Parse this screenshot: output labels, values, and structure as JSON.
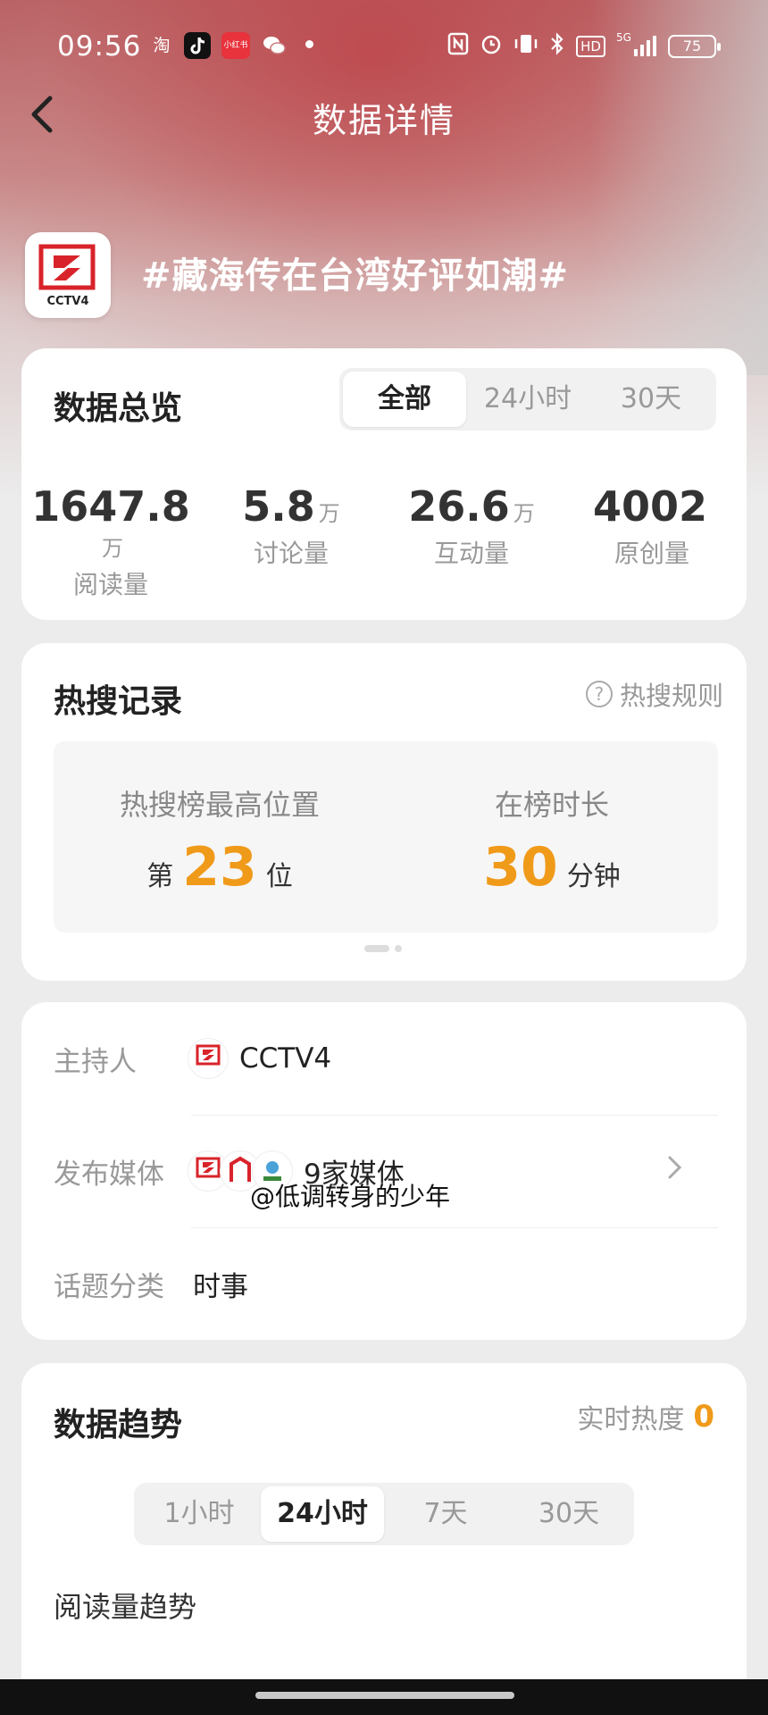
{
  "status_bar": {
    "time": "09:56",
    "apps": [
      {
        "name": "taobao-icon",
        "glyph": "淘",
        "bg": "transparent"
      },
      {
        "name": "tiktok-icon",
        "glyph": "♪",
        "bg": "#111111"
      },
      {
        "name": "xiaohongshu-icon",
        "glyph": "小红书",
        "bg": "#e8323c"
      },
      {
        "name": "wechat-icon",
        "glyph": "●",
        "bg": "transparent"
      }
    ],
    "right_icons": [
      "nfc-icon",
      "alarm-icon",
      "vibrate-icon",
      "bluetooth-icon",
      "hd-icon",
      "signal-5g-icon"
    ],
    "hd_label": "HD",
    "net_label": "5G",
    "battery": "75"
  },
  "nav": {
    "title": "数据详情"
  },
  "topic": {
    "title": "#藏海传在台湾好评如潮#",
    "logo_text": "CCTV4"
  },
  "overview": {
    "title": "数据总览",
    "tabs": [
      "全部",
      "24小时",
      "30天"
    ],
    "active_tab": 0,
    "stats": [
      {
        "value": "1647.8",
        "unit": "万",
        "label": "阅读量"
      },
      {
        "value": "5.8",
        "unit": "万",
        "label": "讨论量"
      },
      {
        "value": "26.6",
        "unit": "万",
        "label": "互动量"
      },
      {
        "value": "4002",
        "unit": "",
        "label": "原创量"
      }
    ]
  },
  "hot_search": {
    "title": "热搜记录",
    "rules_label": "热搜规则",
    "highest": {
      "label": "热搜榜最高位置",
      "prefix": "第",
      "value": "23",
      "suffix": "位"
    },
    "duration": {
      "label": "在榜时长",
      "value": "30",
      "suffix": "分钟"
    }
  },
  "info": {
    "host_label": "主持人",
    "host_name": "CCTV4",
    "media_label": "发布媒体",
    "media_value": "9家媒体",
    "category_label": "话题分类",
    "category_value": "时事"
  },
  "watermark": "@低调转身的少年",
  "trend": {
    "title": "数据趋势",
    "realtime_label": "实时热度",
    "realtime_value": "0",
    "tabs": [
      "1小时",
      "24小时",
      "7天",
      "30天"
    ],
    "active_tab": 1,
    "subtitle": "阅读量趋势"
  },
  "colors": {
    "accent": "#f09a1a",
    "cctv_red": "#d8232a"
  }
}
